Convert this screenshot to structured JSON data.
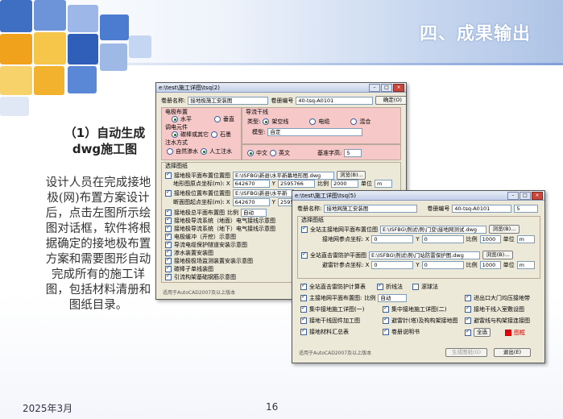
{
  "slide": {
    "title": "四、成果输出",
    "subtitle_line1": "（1）自动生成",
    "subtitle_line2": "dwg施工图",
    "body": "设计人员在完成接地极(网)布置方案设计后，点击左图所示绘图对话框，软件将根据确定的接地极布置方案和需要图形自动完成所有的施工详图，包括材料清册和图纸目录。",
    "date": "2025年3月",
    "page": "16"
  },
  "win1": {
    "title": "e:\\test\\施工详图\\tsq(2)",
    "vol_name_label": "卷册名称:",
    "vol_name_value": "接地极施工安装图",
    "vol_no_label": "卷册编号",
    "vol_no_value": "40-tsq-A0101",
    "ok_button": "确定(O)",
    "elec_layout": "电极布置",
    "horizontal": "水平",
    "vertical": "垂直",
    "adjust_elem": "调电元件",
    "other": "碳棒或其它",
    "graphite": "石墨",
    "grout": "注水方式",
    "self_seep": "自然渗水",
    "manual": "人工注水",
    "conductor": "导流干线",
    "type_label": "类型:",
    "overhead": "架空线",
    "cable": "电缆",
    "mixed": "混合",
    "model_label": "模型:",
    "model_value": "自定",
    "chinese": "中文",
    "english": "英文",
    "font_label": "基准字高:",
    "font_value": "5",
    "select_fig": "选择图纸",
    "plan_label": "接地极平面布置位置图",
    "plan_path": "E:\\ISFBG\\新县\\水平新幕地形图.dwg",
    "browse": "浏览(B)...",
    "origin_label": "地形图原点坐标(m): X",
    "origin_x": "642670",
    "origin_y": "2595766",
    "scale_label": "比例",
    "scale_value": "2000",
    "unit_label": "单位",
    "unit_value": "m",
    "plan2_label": "接地极位置布置位置图",
    "plan2_path": "E:\\ISFBG\\新县\\水平新",
    "start_label": "断面图起点坐标(m): X",
    "start_x": "642670",
    "start_y": "2595766",
    "checks": [
      "接地极总平面布置图",
      "接地极导流系统（地面）电气接线示意图",
      "接地极导流系统（地下）电气接线示意图",
      "电极缓冲（开挖）示意图",
      "导流电缆保护隧道安装示意图",
      "渗水装置安装图",
      "接地极极场监测装置安装示意图",
      "碳棒子单线装图",
      "引流构架基础钢筋示意图"
    ],
    "scale2_label": "比例",
    "scale2_value": "自动",
    "status": "适用于AutoCAD2007及以上版本"
  },
  "win2": {
    "title": "e:\\test\\施工详图\\tsq(5)",
    "vol_name_label": "卷册名称:",
    "vol_name_value": "接地网施工安装图",
    "vol_no_label": "卷册编号",
    "vol_no_value": "40-tsq-A0101",
    "vol_no_extra": "5",
    "select_fig": "选择图纸",
    "main_plan_label": "全站主接地网平面布置位图",
    "main_plan_path": "E:\\ISFBG\\例试\\例\\门变\\接地网测试.dwg",
    "browse": "浏览(B)...",
    "ref_label": "接地网参点坐标: X",
    "ref_x": "0",
    "ref_y": "0",
    "scale_label": "比例",
    "scale_value": "1000",
    "unit_label": "单位",
    "unit_value": "m",
    "lightning_label": "全站直击雷防护平面图",
    "lightning_path": "E:\\ISFBG\\例试\\例\\门站防雷保护图.dwg",
    "light_ref_label": "避雷针参点坐标: X",
    "light_ref_x": "0",
    "light_ref_y": "0",
    "light_scale_value": "1000",
    "light_unit_value": "m",
    "calc_label": "全站直击雷防护计算表",
    "fold_label": "折线法",
    "roll_label": "滚球法",
    "grid_label": "主接地网平面布置图:",
    "grid_scale_label": "比例",
    "grid_scale_value": "自动",
    "gate_label": "进出口大门均压接地带",
    "checks_left": [
      "集中接地施工详图(一)",
      "接地干线固件加工图",
      "接地材料汇总表"
    ],
    "checks_mid": [
      "集中接地施工详图(二)",
      "避雷针(塔)及构构架接地图",
      "卷册说明书"
    ],
    "checks_right": [
      "接地干线入室敷设图",
      "避雷线与构架接连接图",
      "全选",
      "图框"
    ],
    "status": "适用于AutoCAD2007及以上版本",
    "generate_button": "生成图纸(G)",
    "exit_button": "退出(E)"
  },
  "colors": {
    "title_text": "#ffffff",
    "dialog_bg": "#ece9d8",
    "pink_group": "#f6c8c8"
  }
}
